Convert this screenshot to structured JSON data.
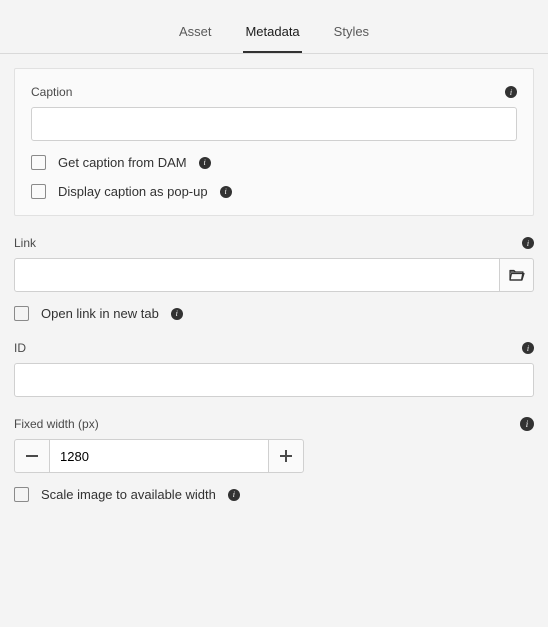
{
  "tabs": {
    "asset": "Asset",
    "metadata": "Metadata",
    "styles": "Styles"
  },
  "caption": {
    "label": "Caption",
    "value": "",
    "getFromDam": "Get caption from DAM",
    "displayPopup": "Display caption as pop-up"
  },
  "link": {
    "label": "Link",
    "value": "",
    "openNewTab": "Open link in new tab"
  },
  "id": {
    "label": "ID",
    "value": ""
  },
  "fixedWidth": {
    "label": "Fixed width (px)",
    "value": "1280"
  },
  "scaleToWidth": {
    "label": "Scale image to available width"
  }
}
